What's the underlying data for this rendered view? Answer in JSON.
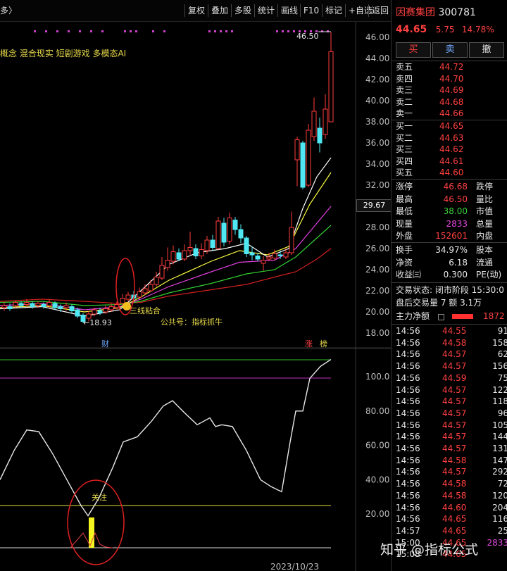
{
  "toolbar": {
    "breadcrumb": "多〉",
    "buttons": [
      "复权",
      "叠加",
      "多股",
      "统计",
      "画线",
      "F10",
      "标记",
      "+自选",
      "返回"
    ]
  },
  "chart": {
    "concepts": "概念 混合现实 短剧游戏 多模态AI",
    "peak_label": "46.50",
    "low_label": "←18.93",
    "price_marker": "29.67",
    "yaxis": [
      "46.00",
      "44.00",
      "42.00",
      "40.00",
      "38.00",
      "36.00",
      "34.00",
      "32.00",
      "30.00",
      "28.00",
      "26.00",
      "24.00",
      "22.00",
      "20.00",
      "18.00"
    ],
    "note_sanxian": "三线粘合",
    "note_public": "公共号：指标抓牛",
    "marker_cai": "财",
    "marker_zhang": "涨",
    "marker_bang": "榜",
    "colors": {
      "up": "#ff3b3b",
      "down": "#4fe8f2",
      "ma5": "#ffffff",
      "ma10": "#ffff40",
      "ma20": "#e040e0",
      "ma30": "#30d030",
      "ma60": "#d02020"
    }
  },
  "indicator": {
    "yaxis": [
      "100.0",
      "80.00",
      "60.00",
      "40.00",
      "20.00"
    ],
    "note_guanzhu": "关注",
    "date_partial": "2023/10/23"
  },
  "quote": {
    "name": "因赛集团",
    "code": "300781",
    "price": "44.65",
    "change": "5.75",
    "pct": "14.78%",
    "buy_btn": "买",
    "sell_btn": "卖",
    "cancel_btn": "撤",
    "asks": [
      {
        "label": "卖五",
        "price": "44.72"
      },
      {
        "label": "卖四",
        "price": "44.70"
      },
      {
        "label": "卖三",
        "price": "44.69"
      },
      {
        "label": "卖二",
        "price": "44.68"
      },
      {
        "label": "卖一",
        "price": "44.66"
      }
    ],
    "bids": [
      {
        "label": "买一",
        "price": "44.65"
      },
      {
        "label": "买二",
        "price": "44.63"
      },
      {
        "label": "买三",
        "price": "44.62"
      },
      {
        "label": "买四",
        "price": "44.61"
      },
      {
        "label": "买五",
        "price": "44.60"
      }
    ],
    "stats": [
      {
        "k": "涨停",
        "v": "46.68",
        "k2": "跌停"
      },
      {
        "k": "最高",
        "v": "46.50",
        "k2": "量比"
      },
      {
        "k": "最低",
        "v": "38.00",
        "k2": "市值"
      },
      {
        "k": "现量",
        "v": "2833",
        "k2": "总量"
      },
      {
        "k": "外盘",
        "v": "152601",
        "k2": "内盘"
      }
    ],
    "stats2": [
      {
        "k": "换手",
        "v": "34.97%",
        "k2": "股本"
      },
      {
        "k": "净资",
        "v": "6.18",
        "k2": "流通"
      },
      {
        "k": "收益㈢",
        "v": "0.300",
        "k2": "PE(动)"
      }
    ],
    "trade_status": "交易状态: 闭市阶段 15:30:0",
    "after_hours": "盘后交易量 7 额 3.1万",
    "main_net_label": "主力净额",
    "main_net_value": "1872",
    "ticks": [
      {
        "t": "14:56",
        "p": "44.55",
        "v": "91"
      },
      {
        "t": "14:56",
        "p": "44.58",
        "v": "158"
      },
      {
        "t": "14:56",
        "p": "44.57",
        "v": "62"
      },
      {
        "t": "14:56",
        "p": "44.57",
        "v": "156"
      },
      {
        "t": "14:56",
        "p": "44.59",
        "v": "75"
      },
      {
        "t": "14:56",
        "p": "44.57",
        "v": "122"
      },
      {
        "t": "14:56",
        "p": "44.57",
        "v": "118"
      },
      {
        "t": "14:56",
        "p": "44.57",
        "v": "96"
      },
      {
        "t": "14:56",
        "p": "44.57",
        "v": "105"
      },
      {
        "t": "14:56",
        "p": "44.57",
        "v": "144"
      },
      {
        "t": "14:56",
        "p": "44.57",
        "v": "131"
      },
      {
        "t": "14:56",
        "p": "44.58",
        "v": "147"
      },
      {
        "t": "14:56",
        "p": "44.57",
        "v": "292"
      },
      {
        "t": "14:56",
        "p": "44.58",
        "v": "72"
      },
      {
        "t": "14:56",
        "p": "44.58",
        "v": "120"
      },
      {
        "t": "14:56",
        "p": "44.60",
        "v": "204"
      },
      {
        "t": "14:56",
        "p": "44.65",
        "v": "116"
      },
      {
        "t": "14:57",
        "p": "44.65",
        "v": "25"
      },
      {
        "t": "15:00",
        "p": "44.65",
        "v": "2833"
      },
      {
        "t": "15:08",
        "p": "44.65",
        "v": ""
      }
    ]
  },
  "watermark": "知乎 @指标公式"
}
